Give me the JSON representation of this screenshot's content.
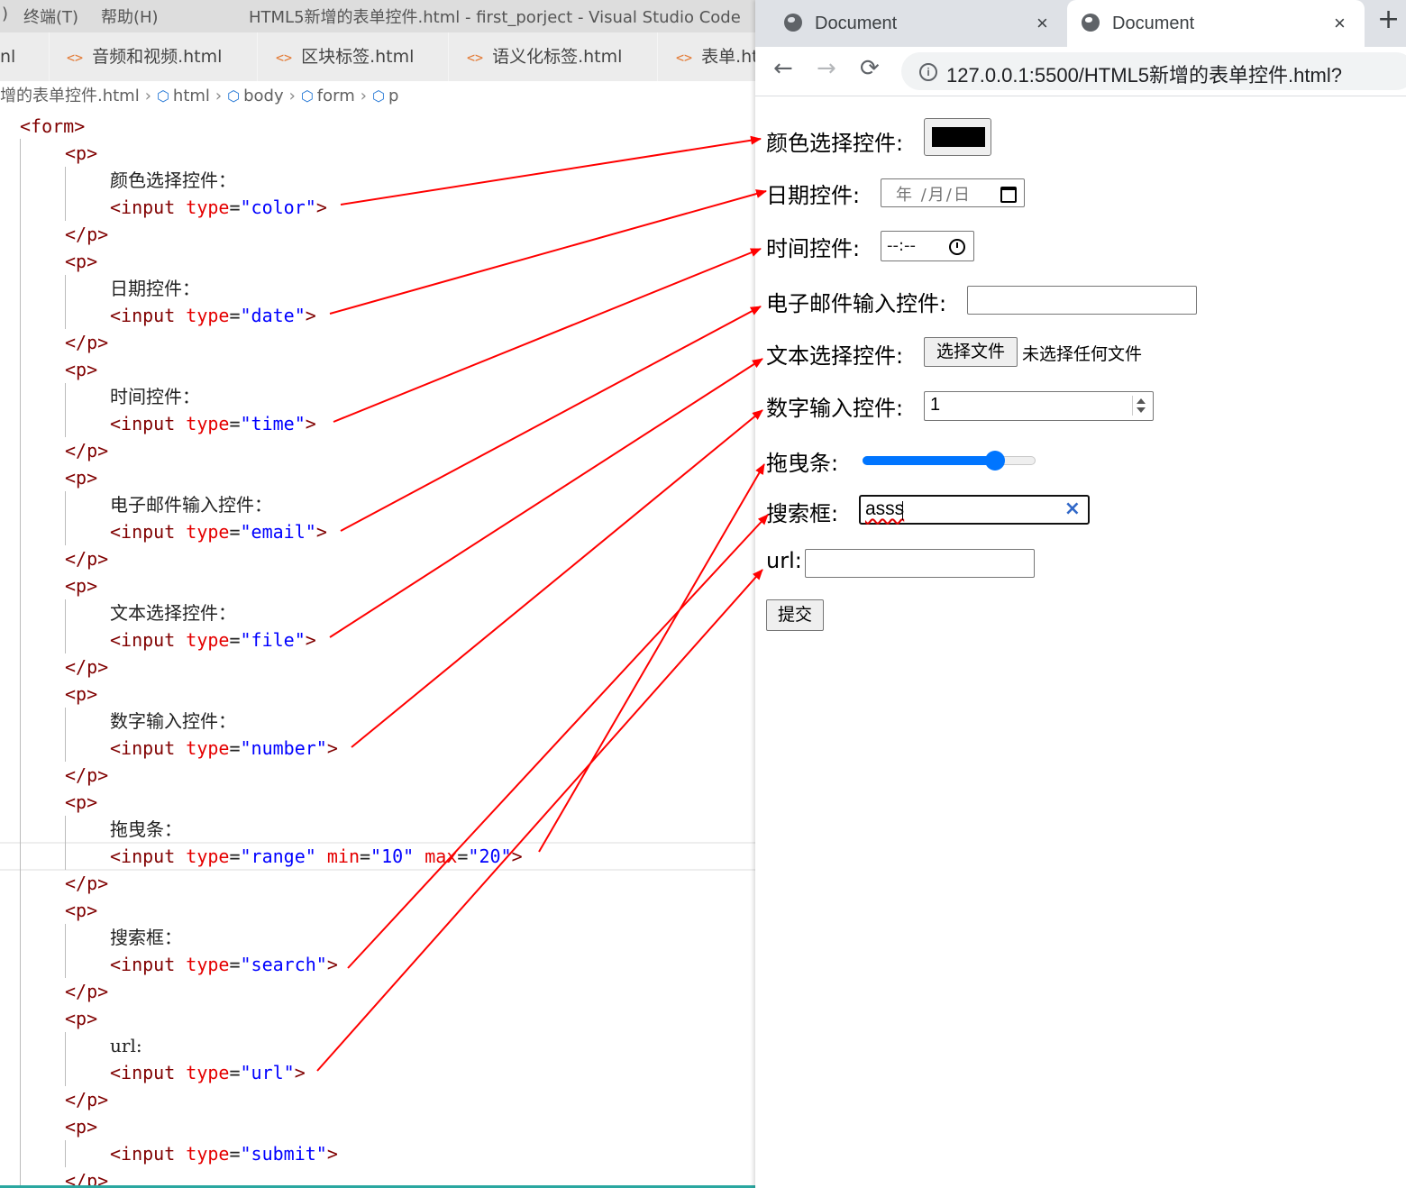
{
  "editor": {
    "menu_terminal": "终端(T)",
    "menu_help": "帮助(H)",
    "window_title": "HTML5新增的表单控件.html - first_porject - Visual Studio Code",
    "tabs": [
      {
        "label": "nl"
      },
      {
        "label": "音频和视频.html"
      },
      {
        "label": "区块标签.html"
      },
      {
        "label": "语义化标签.html"
      },
      {
        "label": "表单.ht"
      }
    ],
    "breadcrumb": {
      "file": "增的表单控件.html",
      "items": [
        "html",
        "body",
        "form",
        "p"
      ]
    },
    "code": {
      "form_open": "<form>",
      "p_open": "<p>",
      "p_close": "</p>",
      "input_open": "<input ",
      "type_attr": "type",
      "eq": "=",
      "close": ">",
      "min_attr": "min",
      "max_attr": "max",
      "min_val": "\"10\"",
      "max_val": "\"20\"",
      "blocks": [
        {
          "label": "颜色选择控件：",
          "type_val": "\"color\""
        },
        {
          "label": "日期控件：",
          "type_val": "\"date\""
        },
        {
          "label": "时间控件：",
          "type_val": "\"time\""
        },
        {
          "label": "电子邮件输入控件：",
          "type_val": "\"email\""
        },
        {
          "label": "文本选择控件：",
          "type_val": "\"file\""
        },
        {
          "label": "数字输入控件：",
          "type_val": "\"number\""
        },
        {
          "label": "拖曳条：",
          "type_val": "\"range\""
        },
        {
          "label": "搜索框：",
          "type_val": "\"search\""
        },
        {
          "label": "url:",
          "type_val": "\"url\""
        },
        {
          "label": "",
          "type_val": "\"submit\""
        }
      ]
    }
  },
  "browser": {
    "tabs": [
      {
        "title": "Document"
      },
      {
        "title": "Document"
      }
    ],
    "new_tab": "+",
    "close_glyph": "×",
    "url": "127.0.0.1:5500/HTML5新增的表单控件.html?",
    "nav": {
      "back": "←",
      "forward": "→",
      "reload": "⟳"
    }
  },
  "form": {
    "color_label": "颜色选择控件:",
    "color_value": "#000000",
    "date_label": "日期控件:",
    "date_placeholder": "年 /月/日",
    "time_label": "时间控件:",
    "time_placeholder": "--:--",
    "email_label": "电子邮件输入控件:",
    "file_label": "文本选择控件:",
    "file_button": "选择文件",
    "file_status": "未选择任何文件",
    "number_label": "数字输入控件:",
    "number_value": "1",
    "range_label": "拖曳条:",
    "range_min": 10,
    "range_max": 20,
    "range_value": 18,
    "search_label": "搜索框:",
    "search_value": "asss",
    "search_clear": "×",
    "url_label": "url:",
    "submit_label": "提交"
  },
  "colors": {
    "arrow": "#ff0000",
    "accent": "#0075ff",
    "tag": "#800000",
    "attr": "#e50000",
    "value": "#0000ff"
  }
}
